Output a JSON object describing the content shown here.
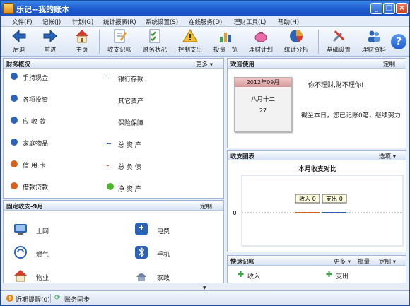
{
  "window": {
    "title": "乐记--我的账本"
  },
  "menu": [
    "文件(F)",
    "记帐(J)",
    "计划(G)",
    "统计报表(R)",
    "系统设置(S)",
    "在线服务(D)",
    "理财工具(L)",
    "帮助(H)"
  ],
  "toolbar": {
    "back": "后退",
    "forward": "前进",
    "home": "主页",
    "record": "收支记帐",
    "finance_status": "财务状况",
    "control": "控制支出",
    "overview": "投资一览",
    "plan": "理财计划",
    "analysis": "统计分析",
    "settings": "基础设置",
    "resources": "理财资料",
    "help": "?"
  },
  "finance": {
    "title": "财务概况",
    "more": "更多 ▾",
    "left": [
      {
        "label": "手持现金",
        "color": "#2a63b8"
      },
      {
        "label": "各项投资",
        "color": "#2a63b8"
      },
      {
        "label": "应 收 款",
        "color": "#2a63b8"
      },
      {
        "label": "家庭物品",
        "color": "#2a63b8"
      },
      {
        "label": "信 用 卡",
        "color": "#d9601c"
      },
      {
        "label": "借款贷款",
        "color": "#d9601c"
      }
    ],
    "right": [
      "银行存款",
      "其它资产",
      "保险保障",
      "总 资 产",
      "总 负 债",
      "净 资 产"
    ]
  },
  "welcome": {
    "title": "欢迎使用",
    "custom": "定制",
    "cal_month": "2012年09月",
    "cal_lunar": "八月十二",
    "cal_day": "27",
    "slogan": "你不理财,财不理你!",
    "summary": "截至本日，您已记账0笔，继续努力"
  },
  "fixed": {
    "title": "固定收支-9月",
    "custom": "定制",
    "items": [
      "上网",
      "电费",
      "燃气",
      "手机",
      "物业",
      "家政"
    ]
  },
  "chart": {
    "title": "收支图表",
    "options": "选项 ▾",
    "subtitle": "本月收支对比"
  },
  "chart_data": {
    "type": "bar",
    "categories": [
      "收入",
      "支出"
    ],
    "values": [
      0,
      0
    ],
    "title": "本月收支对比",
    "y_tick": "0"
  },
  "quick": {
    "title": "快速记帐",
    "more": "更多 ▾",
    "batch": "批量",
    "custom": "定制 ▾",
    "income": "收入",
    "expense": "支出"
  },
  "status": {
    "reminder": "近期提醒(0)",
    "sync": "账务同步"
  },
  "colors": {
    "accent": "#1d5bd0",
    "income": "#d9601c",
    "expense": "#2a63b8"
  }
}
